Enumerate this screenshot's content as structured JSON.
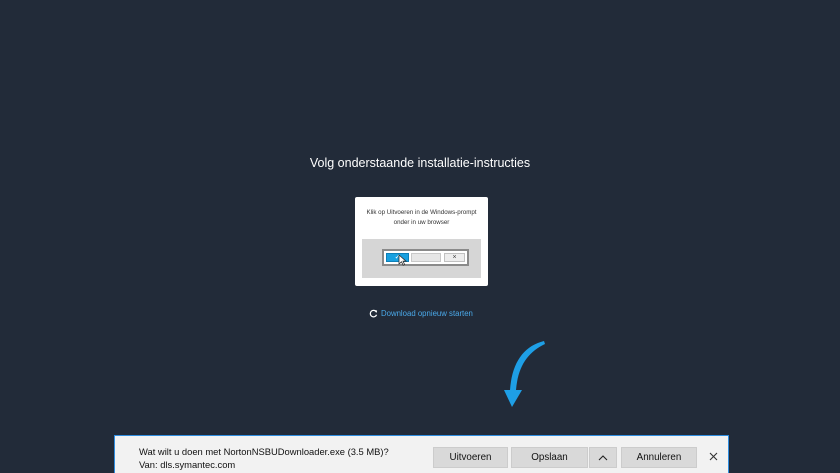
{
  "heading": "Volg onderstaande installatie-instructies",
  "instruction_card": {
    "text": "Klik op Uitvoeren in de Windows-prompt onder in uw browser",
    "run_check_icon": "✓",
    "close_mark": "×",
    "accent_color": "#18a0e0"
  },
  "restart_link": {
    "label": "Download opnieuw starten",
    "icon": "refresh-icon",
    "color": "#4aa8e8"
  },
  "download_bar": {
    "question": "Wat wilt u doen met NortonNSBUDownloader.exe (3.5 MB)?",
    "source": "Van: dls.symantec.com",
    "run_label": "Uitvoeren",
    "save_label": "Opslaan",
    "chevron_icon": "chevron-up-icon",
    "cancel_label": "Annuleren",
    "close_icon": "close-icon",
    "border_color": "#2f8de0"
  },
  "colors": {
    "background": "#222b39",
    "arrow": "#1e9fe6"
  }
}
